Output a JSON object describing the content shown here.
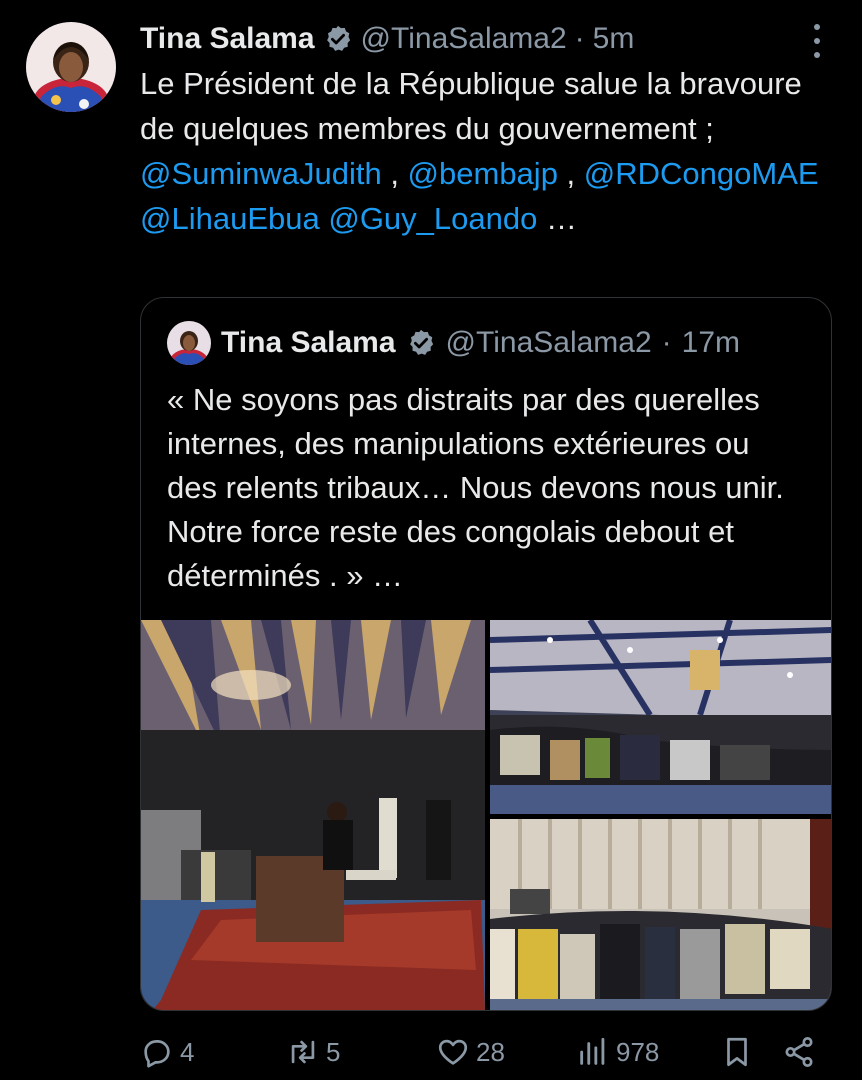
{
  "tweet": {
    "author_name": "Tina Salama",
    "handle": "@TinaSalama2",
    "separator": "·",
    "time": "5m",
    "text_parts": [
      {
        "text": "Le Président de la République salue la bravoure de quelques membres du gouvernement ; ",
        "mention": false
      },
      {
        "text": "@SuminwaJudith",
        "mention": true
      },
      {
        "text": " , ",
        "mention": false
      },
      {
        "text": "@bembajp",
        "mention": true
      },
      {
        "text": " , ",
        "mention": false
      },
      {
        "text": "@RDCongoMAE",
        "mention": true
      },
      {
        "text": " ",
        "mention": false
      },
      {
        "text": "@LihauEbua",
        "mention": true
      },
      {
        "text": " ",
        "mention": false
      },
      {
        "text": "@Guy_Loando",
        "mention": true
      },
      {
        "text": " …",
        "mention": false
      }
    ]
  },
  "quoted": {
    "author_name": "Tina Salama",
    "handle": "@TinaSalama2",
    "separator": "·",
    "time": "17m",
    "text": "« Ne soyons pas distraits par des querelles internes, des manipulations extérieures ou des relents tribaux… Nous devons nous unir. Notre force reste des congolais debout et déterminés . » …"
  },
  "actions": {
    "replies": "4",
    "reposts": "5",
    "likes": "28",
    "views": "978"
  },
  "colors": {
    "background": "#000000",
    "text": "#e7e9ea",
    "muted": "#8b98a5",
    "link": "#1d9bf0",
    "border": "#2f3336"
  }
}
